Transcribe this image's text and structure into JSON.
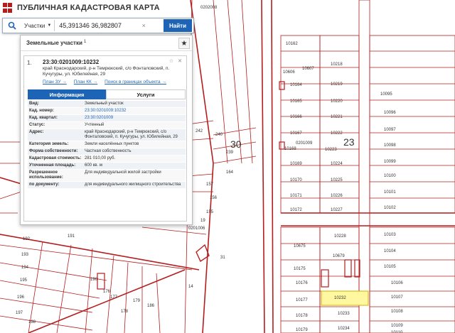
{
  "app": {
    "title": "ПУБЛИЧНАЯ КАДАСТРОВАЯ КАРТА"
  },
  "search": {
    "type_label": "Участки",
    "value": "45,391346 36,982807",
    "clear_label": "×",
    "find_label": "Найти"
  },
  "panel": {
    "title": "Земельные участки",
    "count": "1",
    "pin_label": "★",
    "result": {
      "index": "1.",
      "cad_number": "23:30:0201009:10232",
      "address": "край Краснодарский, р-н Темрюкский, с/о Фонталовский, п. Кучугуры, ул. Юбилейная, 29",
      "links": [
        "План ЗУ →",
        "План КК →",
        "Поиск в границах объекта →"
      ],
      "tabs": [
        "Информация",
        "Услуги"
      ],
      "properties": [
        {
          "key": "Вид:",
          "value": "Земельный участок"
        },
        {
          "key": "Кад. номер:",
          "value": "23:30:0201009:10232"
        },
        {
          "key": "Кад. квартал:",
          "value": "23:30:0201009"
        },
        {
          "key": "Статус:",
          "value": "Учтенный"
        },
        {
          "key": "Адрес:",
          "value": "край Краснодарский, р-н Темрюкский, с/о Фонталовский, п. Кучугуры, ул. Юбилейная, 29"
        },
        {
          "key": "Категория земель:",
          "value": "Земли населённых пунктов"
        },
        {
          "key": "Форма собственности:",
          "value": "Частная собственность"
        },
        {
          "key": "Кадастровая стоимость:",
          "value": "281 010,00 руб."
        },
        {
          "key": "Уточненная площадь:",
          "value": "600 кв. м"
        },
        {
          "key": "Разрешенное использование:",
          "value": "Для индивидуальной жилой застройки"
        },
        {
          "key": "по документу:",
          "value": "для индивидуального жилищного строительства"
        }
      ]
    }
  },
  "map": {
    "quarter_labels": [
      "30",
      "23"
    ],
    "block_labels": [
      "0202008",
      "0201009",
      "0201006"
    ],
    "parcel_labels": [
      "10162",
      "10218",
      "10606",
      "10607",
      "10164",
      "10219",
      "10165",
      "10220",
      "10166",
      "10221",
      "10167",
      "10222",
      "10168",
      "10223",
      "10169",
      "10224",
      "10170",
      "10225",
      "10171",
      "10226",
      "10172",
      "10227",
      "10095",
      "10096",
      "10097",
      "10098",
      "10099",
      "10100",
      "10101",
      "10102",
      "10103",
      "10104",
      "10105",
      "10228",
      "10675",
      "10679",
      "10175",
      "10176",
      "10177",
      "10232",
      "10178",
      "10233",
      "10179",
      "10234",
      "10106",
      "10107",
      "10108",
      "10109",
      "10110",
      "242",
      "240",
      "239",
      "164",
      "157",
      "156",
      "155",
      "19",
      "31",
      "14",
      "176",
      "177",
      "178",
      "179",
      "186",
      "190",
      "191",
      "192",
      "193",
      "194",
      "195",
      "196",
      "197",
      "198"
    ],
    "colors": {
      "parcel": "#b51d1d",
      "selected": "#fff8a0",
      "accent": "#1e64b6"
    }
  }
}
